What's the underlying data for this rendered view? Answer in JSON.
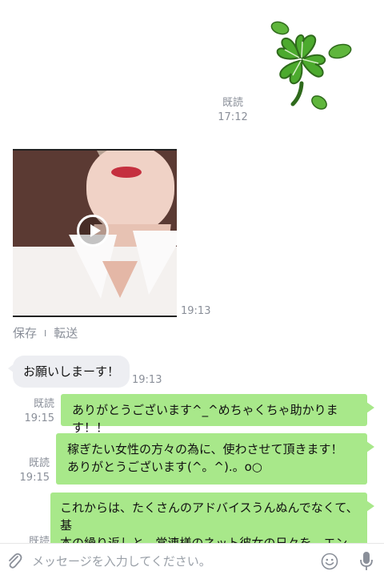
{
  "messages": {
    "sticker": {
      "icon": "four-leaf-clover-sticker",
      "read_label": "既読",
      "time": "17:12"
    },
    "video": {
      "time": "19:13",
      "icon": "play-icon",
      "actions": {
        "save": "保存",
        "separator": "I",
        "forward": "転送"
      }
    },
    "incoming_1": {
      "text": "お願いしまーす！",
      "time": "19:13"
    },
    "outgoing_1": {
      "text": "ありがとうございます^_^めちゃくちゃ助かります！！",
      "read_label": "既読",
      "time": "19:15"
    },
    "outgoing_2": {
      "line1": "稼ぎたい女性の方々の為に、使わさせて頂きます！",
      "line2": "ありがとうございます(^。^).。o○",
      "read_label": "既読",
      "time": "19:15"
    },
    "outgoing_3": {
      "line1": "これからは、たくさんのアドバイスうんぬんでなくて、基",
      "line2": "本の繰り返しと、常連様のネット彼女の日々を、エン",
      "read_label": "既読"
    }
  },
  "input_bar": {
    "placeholder": "メッセージを入力してください。",
    "attach_icon": "paperclip-icon",
    "emoji_icon": "smiley-icon",
    "mic_icon": "microphone-icon"
  },
  "colors": {
    "outgoing_bubble": "#a8e88a",
    "incoming_bubble": "#edeef2",
    "meta_text": "#8a8f99"
  }
}
